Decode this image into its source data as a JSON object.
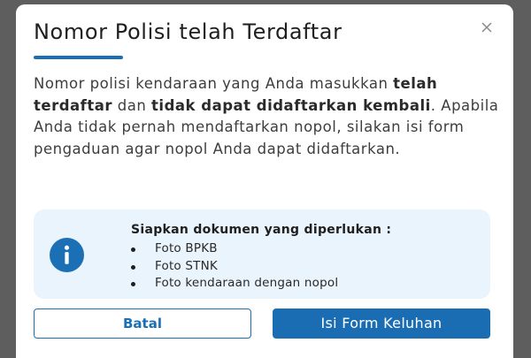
{
  "dialog": {
    "title": "Nomor Polisi telah Terdaftar",
    "close_icon": "close-icon",
    "message": {
      "part1": "Nomor polisi kendaraan yang Anda masukkan ",
      "bold1": "telah terdaftar",
      "part2": " dan ",
      "bold2": "tidak dapat didaftarkan kembali",
      "part3": ". Apabila Anda tidak pernah mendaftarkan nopol, silakan isi form pengaduan agar nopol Anda dapat didaftarkan."
    },
    "info_box": {
      "icon": "info-icon",
      "heading": "Siapkan dokumen yang diperlukan :",
      "items": [
        "Foto BPKB",
        "Foto STNK",
        "Foto kendaraan dengan nopol"
      ]
    },
    "buttons": {
      "cancel_label": "Batal",
      "submit_label": "Isi Form Keluhan"
    }
  },
  "colors": {
    "accent": "#1b6fb5",
    "info_bg": "#eaf4fc",
    "backdrop": "#5e5e5e"
  }
}
